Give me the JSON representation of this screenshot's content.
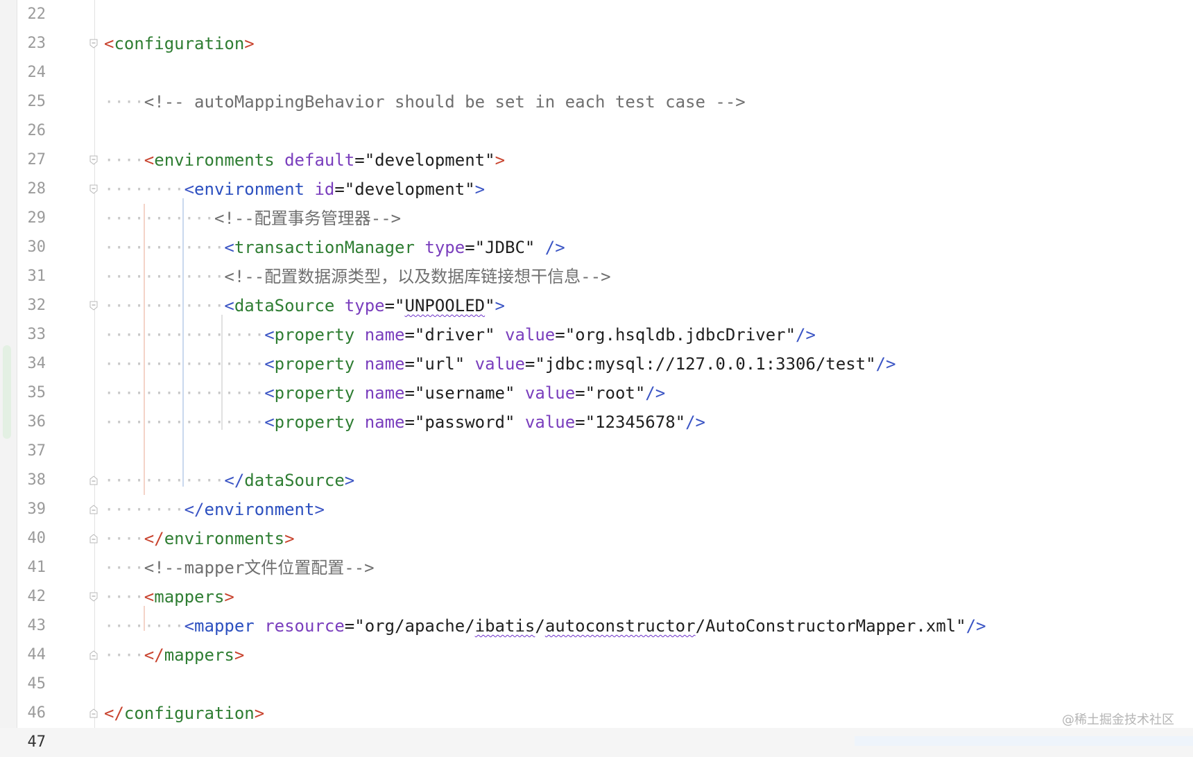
{
  "editor": {
    "lines": [
      {
        "num": "22",
        "current": false,
        "fold": "",
        "text": ""
      },
      {
        "num": "23",
        "current": false,
        "fold": "open",
        "text": "<configuration>"
      },
      {
        "num": "24",
        "current": false,
        "fold": "",
        "text": ""
      },
      {
        "num": "25",
        "current": false,
        "fold": "",
        "text": "<!-- autoMappingBehavior should be set in each test case -->"
      },
      {
        "num": "26",
        "current": false,
        "fold": "",
        "text": ""
      },
      {
        "num": "27",
        "current": false,
        "fold": "open",
        "text": "<environments default=\"development\">"
      },
      {
        "num": "28",
        "current": false,
        "fold": "open",
        "text": "<environment id=\"development\">"
      },
      {
        "num": "29",
        "current": false,
        "fold": "",
        "text": "<!--配置事务管理器-->"
      },
      {
        "num": "30",
        "current": false,
        "fold": "",
        "text": "<transactionManager type=\"JDBC\" />"
      },
      {
        "num": "31",
        "current": false,
        "fold": "",
        "text": "<!--配置数据源类型，以及数据库链接想干信息-->"
      },
      {
        "num": "32",
        "current": false,
        "fold": "open",
        "text": "<dataSource type=\"UNPOOLED\">"
      },
      {
        "num": "33",
        "current": false,
        "fold": "",
        "text": "<property name=\"driver\" value=\"org.hsqldb.jdbcDriver\"/>"
      },
      {
        "num": "34",
        "current": false,
        "fold": "",
        "text": "<property name=\"url\" value=\"jdbc:mysql://127.0.0.1:3306/test\"/>"
      },
      {
        "num": "35",
        "current": false,
        "fold": "",
        "text": "<property name=\"username\" value=\"root\"/>"
      },
      {
        "num": "36",
        "current": false,
        "fold": "",
        "text": "<property name=\"password\" value=\"12345678\"/>"
      },
      {
        "num": "37",
        "current": false,
        "fold": "",
        "text": ""
      },
      {
        "num": "38",
        "current": false,
        "fold": "close",
        "text": "</dataSource>"
      },
      {
        "num": "39",
        "current": false,
        "fold": "close",
        "text": "</environment>"
      },
      {
        "num": "40",
        "current": false,
        "fold": "close",
        "text": "</environments>"
      },
      {
        "num": "41",
        "current": false,
        "fold": "",
        "text": "<!--mapper文件位置配置-->"
      },
      {
        "num": "42",
        "current": false,
        "fold": "open",
        "text": "<mappers>"
      },
      {
        "num": "43",
        "current": false,
        "fold": "",
        "text": "<mapper resource=\"org/apache/ibatis/autoconstructor/AutoConstructorMapper.xml\"/>"
      },
      {
        "num": "44",
        "current": false,
        "fold": "close",
        "text": "</mappers>"
      },
      {
        "num": "45",
        "current": false,
        "fold": "",
        "text": ""
      },
      {
        "num": "46",
        "current": false,
        "fold": "close",
        "text": "</configuration>"
      },
      {
        "num": "47",
        "current": true,
        "fold": "",
        "text": ""
      }
    ]
  },
  "watermark": "@稀土掘金技术社区",
  "colors": {
    "tag_green": "#2e7d32",
    "tag_blue": "#2b4fbf",
    "attribute": "#7a3ebd",
    "bracket_red": "#c8432e",
    "comment": "#6f6f6f",
    "line_number": "#9a9a9a"
  }
}
